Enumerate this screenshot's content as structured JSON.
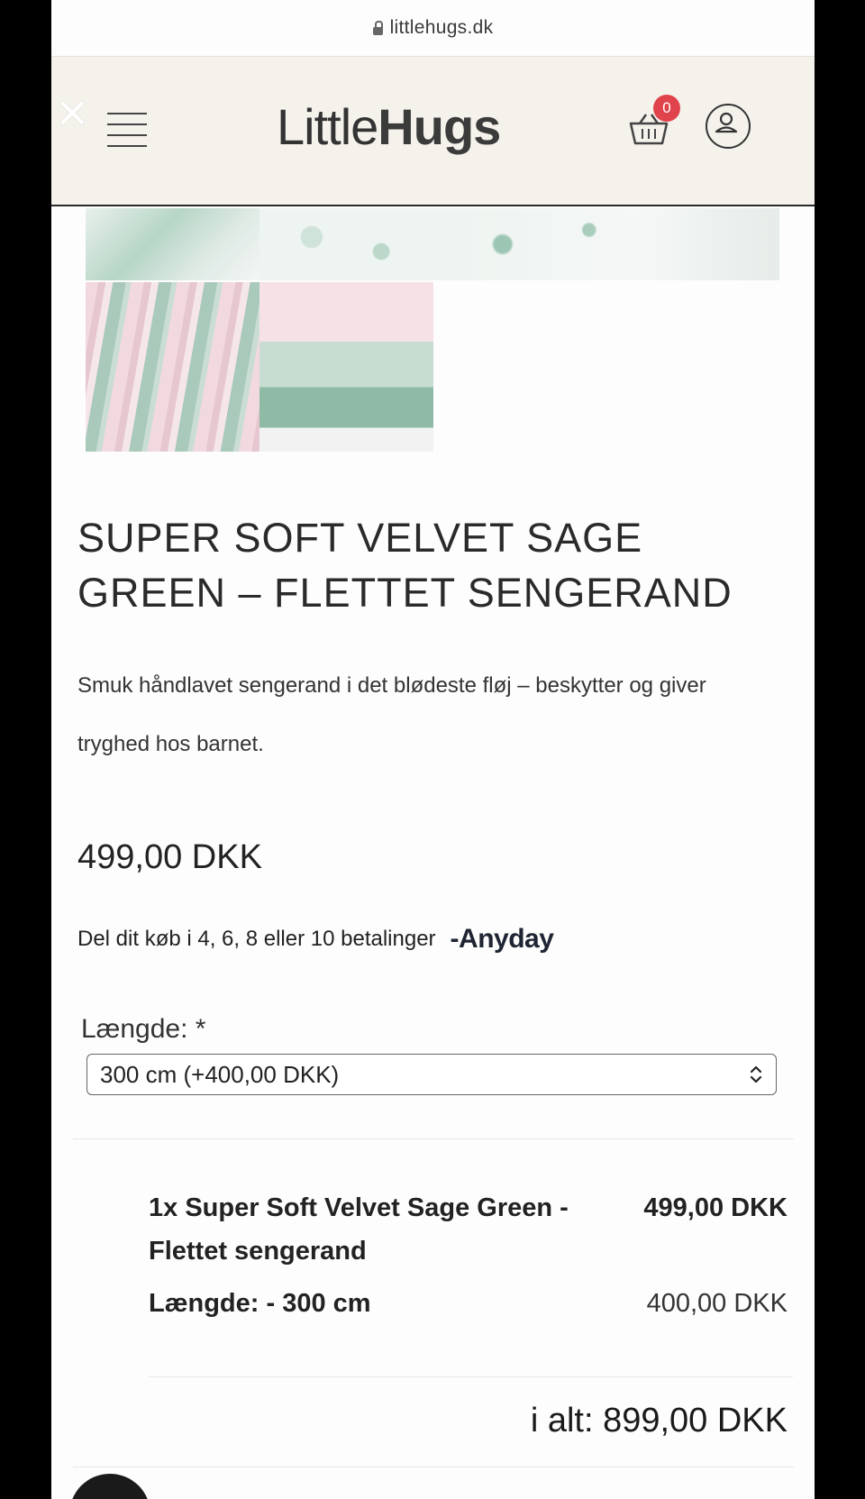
{
  "browser": {
    "url": "littlehugs.dk"
  },
  "header": {
    "logo_light": "Little",
    "logo_bold": "Hugs",
    "cart_count": "0"
  },
  "product": {
    "title": "SUPER SOFT VELVET SAGE GREEN – FLETTET SENGERAND",
    "description": "Smuk håndlavet sengerand i det blødeste fløj – beskytter og giver tryghed hos barnet.",
    "price": "499,00 DKK",
    "installments_text": "Del dit køb i 4, 6, 8 eller 10 betalinger",
    "installments_brand": "Anyday"
  },
  "options": {
    "length_label": "Længde: *",
    "length_selected": "300 cm (+400,00 DKK)"
  },
  "summary": {
    "item_name": "1x Super Soft Velvet Sage Green - Flettet sengerand",
    "item_price": "499,00 DKK",
    "option_label": "Længde: - 300 cm",
    "option_price": "400,00 DKK",
    "total": "i alt: 899,00 DKK"
  },
  "colors": {
    "header_bg": "#f5f2ec",
    "badge": "#e0434b",
    "sage": "#9fc4b4",
    "blush": "#f0d9df"
  }
}
